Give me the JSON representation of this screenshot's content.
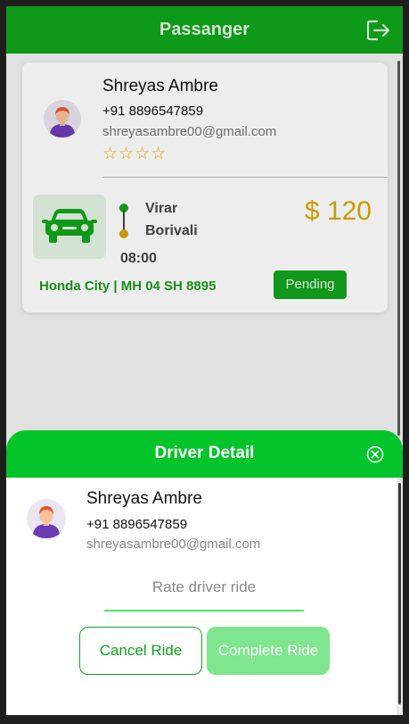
{
  "header": {
    "title": "Passanger",
    "logout_icon": "logout-icon"
  },
  "ride_card": {
    "passenger": {
      "name": "Shreyas Ambre",
      "phone": "+91 8896547859",
      "email": "shreyasambre00@gmail.com",
      "rating_display": "☆☆☆☆",
      "rating": 0,
      "rating_max": 4
    },
    "route": {
      "from": "Virar",
      "to": "Borivali"
    },
    "time": "08:00",
    "price": "$ 120",
    "vehicle": "Honda City | MH 04 SH 8895",
    "status": "Pending",
    "car_icon": "car-icon"
  },
  "driver_detail": {
    "title": "Driver Detail",
    "close_icon": "close-circle-icon",
    "name": "Shreyas Ambre",
    "phone": "+91 8896547859",
    "email": "shreyasambre00@gmail.com",
    "rate_placeholder": "Rate driver ride",
    "cancel_label": "Cancel Ride",
    "complete_label": "Complete Ride"
  },
  "colors": {
    "header_green": "#11a51b",
    "sheet_header_green": "#04c42b",
    "price_gold": "#d8a800",
    "complete_button": "#7fe58e"
  }
}
